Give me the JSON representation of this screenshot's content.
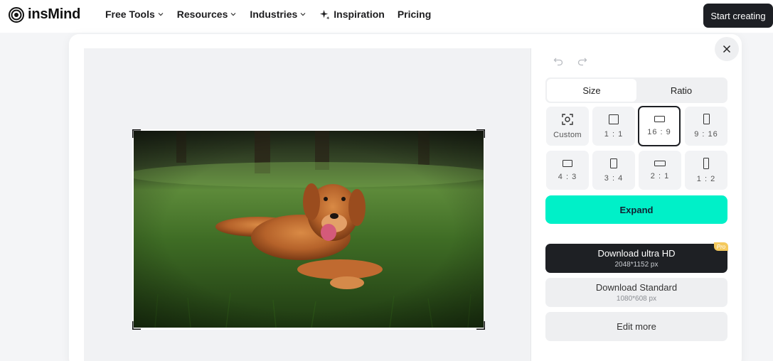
{
  "header": {
    "logo_text": "insMind",
    "nav": [
      {
        "label": "Free Tools",
        "has_dropdown": true
      },
      {
        "label": "Resources",
        "has_dropdown": true
      },
      {
        "label": "Industries",
        "has_dropdown": true
      },
      {
        "label": "Inspiration",
        "has_dropdown": false,
        "icon": "sparkle-icon"
      },
      {
        "label": "Pricing",
        "has_dropdown": false
      }
    ],
    "cta_label": "Start creating"
  },
  "editor": {
    "image_subject": "golden retriever lying on grass",
    "selected_ratio": "16 : 9"
  },
  "panel": {
    "tabs": [
      {
        "label": "Size",
        "active": true
      },
      {
        "label": "Ratio",
        "active": false
      }
    ],
    "ratios": [
      {
        "label": "Custom",
        "icon": "custom-crop-icon"
      },
      {
        "label": "1 : 1",
        "icon": "square-ratio-icon"
      },
      {
        "label": "16 : 9",
        "icon": "landscape-ratio-icon",
        "selected": true
      },
      {
        "label": "9 : 16",
        "icon": "portrait-ratio-icon"
      },
      {
        "label": "4 : 3",
        "icon": "landscape-ratio-icon"
      },
      {
        "label": "3 : 4",
        "icon": "portrait-ratio-icon"
      },
      {
        "label": "2 : 1",
        "icon": "wide-ratio-icon"
      },
      {
        "label": "1 : 2",
        "icon": "tall-ratio-icon"
      }
    ],
    "expand_label": "Expand",
    "download_hd": {
      "label": "Download ultra HD",
      "size": "2048*1152 px",
      "badge": "Pro"
    },
    "download_standard": {
      "label": "Download Standard",
      "size": "1080*608 px"
    },
    "edit_more_label": "Edit more"
  },
  "colors": {
    "accent": "#00f0c8",
    "dark": "#1e2024",
    "pro_badge": "#f4c95d"
  }
}
